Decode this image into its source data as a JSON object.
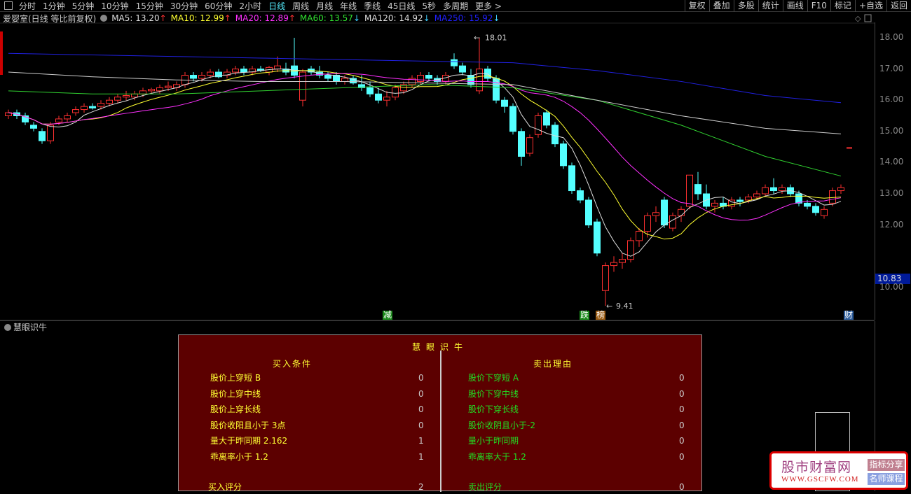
{
  "periods": [
    "分时",
    "1分钟",
    "5分钟",
    "10分钟",
    "15分钟",
    "30分钟",
    "60分钟",
    "2小时",
    "日线",
    "周线",
    "月线",
    "年线",
    "季线",
    "45日线",
    "5秒",
    "多周期",
    "更多 >"
  ],
  "active_period": "日线",
  "right_buttons": [
    "复权",
    "叠加",
    "多股",
    "统计",
    "画线",
    "F10",
    "标记",
    "+自选",
    "返回"
  ],
  "stock_title": "爱婴室(日线 等比前复权)",
  "ma_labels": [
    {
      "text": "MA5: 13.20",
      "arrow": "↑",
      "color": "#dddddd",
      "arrow_color": "#ff3030"
    },
    {
      "text": "MA10: 12.99",
      "arrow": "↑",
      "color": "#ffff30",
      "arrow_color": "#ff3030"
    },
    {
      "text": "MA20: 12.89",
      "arrow": "↑",
      "color": "#ff30ff",
      "arrow_color": "#ff3030"
    },
    {
      "text": "MA60: 13.57",
      "arrow": "↓",
      "color": "#30e030",
      "arrow_color": "#40d0ff"
    },
    {
      "text": "MA120: 14.92",
      "arrow": "↓",
      "color": "#dddddd",
      "arrow_color": "#40d0ff"
    },
    {
      "text": "MA250: 15.92",
      "arrow": "↓",
      "color": "#2020ff",
      "arrow_color": "#40d0ff"
    }
  ],
  "price_axis": [
    "18.00",
    "17.00",
    "16.00",
    "15.00",
    "14.00",
    "13.00",
    "12.00",
    "10.00"
  ],
  "current_price": "10.83",
  "annotations": {
    "high": "18.01",
    "low": "9.41"
  },
  "signals": [
    {
      "text": "减",
      "color": "#1a8a1a"
    },
    {
      "text": "跌",
      "color": "#1a8a1a"
    },
    {
      "text": "榜",
      "color": "#9a5a10"
    },
    {
      "text": "财",
      "color": "#2a5a9a"
    }
  ],
  "chart_data": {
    "type": "candlestick",
    "ylim": [
      9.2,
      18.4
    ],
    "up_color": "#ff3030",
    "down_color": "#54ffff",
    "candles": [
      [
        15.5,
        15.7,
        15.4,
        15.6
      ],
      [
        15.6,
        15.7,
        15.4,
        15.5
      ],
      [
        15.5,
        15.6,
        15.2,
        15.3
      ],
      [
        15.2,
        15.3,
        15.0,
        15.1
      ],
      [
        15.0,
        15.1,
        14.6,
        14.7
      ],
      [
        14.7,
        15.3,
        14.6,
        15.2
      ],
      [
        15.3,
        15.5,
        15.2,
        15.4
      ],
      [
        15.4,
        15.6,
        15.3,
        15.5
      ],
      [
        15.6,
        15.8,
        15.5,
        15.7
      ],
      [
        15.7,
        15.9,
        15.6,
        15.8
      ],
      [
        15.8,
        15.9,
        15.7,
        15.75
      ],
      [
        15.8,
        16.0,
        15.7,
        15.9
      ],
      [
        15.9,
        16.1,
        15.8,
        16.0
      ],
      [
        16.0,
        16.2,
        15.9,
        16.1
      ],
      [
        16.1,
        16.3,
        16.0,
        16.15
      ],
      [
        16.1,
        16.3,
        16.0,
        16.2
      ],
      [
        16.2,
        16.4,
        16.1,
        16.3
      ],
      [
        16.3,
        16.4,
        16.2,
        16.35
      ],
      [
        16.3,
        16.5,
        16.2,
        16.4
      ],
      [
        16.4,
        16.6,
        16.3,
        16.45
      ],
      [
        16.4,
        16.6,
        16.3,
        16.5
      ],
      [
        16.5,
        16.9,
        16.4,
        16.8
      ],
      [
        16.8,
        16.9,
        16.6,
        16.7
      ],
      [
        16.7,
        16.9,
        16.6,
        16.8
      ],
      [
        16.8,
        17.0,
        16.7,
        16.9
      ],
      [
        16.9,
        17.0,
        16.7,
        16.75
      ],
      [
        16.8,
        17.0,
        16.7,
        16.9
      ],
      [
        16.9,
        17.1,
        16.8,
        17.0
      ],
      [
        17.0,
        17.1,
        16.8,
        16.9
      ],
      [
        16.9,
        17.1,
        16.8,
        17.0
      ],
      [
        17.0,
        17.1,
        16.9,
        16.95
      ],
      [
        16.9,
        17.1,
        16.8,
        17.05
      ],
      [
        17.0,
        17.4,
        16.9,
        17.1
      ],
      [
        17.0,
        17.2,
        16.8,
        16.9
      ],
      [
        17.1,
        18.0,
        16.7,
        16.8
      ],
      [
        16.0,
        17.0,
        15.8,
        16.9
      ],
      [
        17.0,
        17.1,
        16.8,
        16.9
      ],
      [
        16.9,
        17.1,
        16.7,
        16.8
      ],
      [
        16.8,
        16.9,
        16.6,
        16.7
      ],
      [
        16.8,
        16.9,
        16.5,
        16.6
      ],
      [
        16.6,
        16.8,
        16.5,
        16.7
      ],
      [
        16.7,
        16.8,
        16.5,
        16.55
      ],
      [
        16.5,
        16.8,
        16.3,
        16.4
      ],
      [
        16.4,
        16.6,
        16.1,
        16.2
      ],
      [
        16.2,
        16.4,
        15.9,
        16.0
      ],
      [
        16.0,
        16.3,
        15.8,
        16.1
      ],
      [
        16.1,
        16.5,
        16.0,
        16.4
      ],
      [
        16.3,
        16.6,
        16.2,
        16.5
      ],
      [
        16.5,
        16.8,
        16.4,
        16.7
      ],
      [
        16.6,
        16.9,
        16.5,
        16.8
      ],
      [
        16.8,
        16.9,
        16.6,
        16.7
      ],
      [
        16.7,
        16.8,
        16.5,
        16.6
      ],
      [
        16.6,
        16.9,
        16.5,
        16.8
      ],
      [
        17.3,
        17.5,
        17.0,
        17.1
      ],
      [
        17.1,
        17.2,
        16.8,
        16.9
      ],
      [
        16.8,
        17.0,
        16.4,
        16.5
      ],
      [
        16.3,
        18.01,
        16.2,
        17.0
      ],
      [
        17.0,
        17.1,
        16.6,
        16.7
      ],
      [
        16.7,
        16.8,
        15.9,
        16.0
      ],
      [
        16.0,
        16.1,
        15.6,
        15.8
      ],
      [
        15.8,
        15.9,
        14.9,
        15.0
      ],
      [
        15.0,
        15.1,
        13.9,
        14.2
      ],
      [
        14.3,
        14.9,
        14.2,
        14.8
      ],
      [
        14.9,
        15.6,
        14.8,
        15.5
      ],
      [
        15.6,
        15.7,
        15.1,
        15.2
      ],
      [
        15.2,
        15.3,
        14.5,
        14.6
      ],
      [
        14.6,
        14.7,
        13.8,
        13.9
      ],
      [
        13.9,
        14.0,
        13.0,
        13.1
      ],
      [
        13.1,
        13.2,
        12.7,
        12.8
      ],
      [
        12.8,
        12.9,
        11.9,
        12.0
      ],
      [
        12.1,
        12.2,
        11.0,
        11.1
      ],
      [
        9.9,
        10.8,
        9.41,
        10.7
      ],
      [
        10.7,
        11.0,
        10.5,
        10.8
      ],
      [
        10.8,
        11.1,
        10.6,
        10.9
      ],
      [
        10.9,
        11.6,
        10.8,
        11.5
      ],
      [
        11.5,
        11.9,
        11.3,
        11.8
      ],
      [
        11.8,
        12.4,
        11.6,
        12.3
      ],
      [
        12.3,
        12.6,
        12.1,
        12.4
      ],
      [
        12.8,
        12.9,
        11.9,
        12.0
      ],
      [
        11.9,
        12.4,
        11.8,
        12.3
      ],
      [
        12.3,
        12.6,
        12.1,
        12.5
      ],
      [
        12.6,
        13.6,
        12.5,
        13.6
      ],
      [
        13.3,
        13.7,
        12.8,
        13.0
      ],
      [
        13.0,
        13.3,
        12.5,
        12.6
      ],
      [
        12.6,
        12.8,
        12.4,
        12.7
      ],
      [
        12.7,
        12.9,
        12.5,
        12.6
      ],
      [
        12.6,
        12.9,
        12.5,
        12.8
      ],
      [
        12.8,
        12.9,
        12.6,
        12.75
      ],
      [
        12.8,
        13.0,
        12.7,
        12.9
      ],
      [
        12.9,
        13.1,
        12.8,
        13.0
      ],
      [
        13.0,
        13.3,
        12.9,
        13.2
      ],
      [
        13.2,
        13.5,
        13.0,
        13.1
      ],
      [
        13.1,
        13.3,
        13.0,
        13.2
      ],
      [
        13.2,
        13.3,
        12.9,
        13.0
      ],
      [
        13.0,
        13.1,
        12.6,
        12.7
      ],
      [
        12.7,
        12.8,
        12.5,
        12.6
      ],
      [
        12.6,
        12.7,
        12.3,
        12.4
      ],
      [
        12.3,
        12.6,
        12.2,
        12.5
      ],
      [
        12.7,
        13.2,
        12.6,
        13.1
      ],
      [
        13.1,
        13.3,
        13.0,
        13.2
      ]
    ],
    "ma_computed": [
      {
        "name": "MA5",
        "period": 5,
        "color": "#dddddd"
      },
      {
        "name": "MA10",
        "period": 10,
        "color": "#ffff30"
      },
      {
        "name": "MA20",
        "period": 20,
        "color": "#ff30ff"
      }
    ],
    "ma_sampled": {
      "sample_index": [
        0,
        10,
        20,
        30,
        40,
        50,
        60,
        70,
        80,
        90,
        99
      ],
      "series": [
        {
          "name": "MA60",
          "color": "#30d030",
          "values": [
            16.3,
            16.2,
            16.2,
            16.3,
            16.4,
            16.5,
            16.4,
            16.0,
            15.2,
            14.2,
            13.57
          ]
        },
        {
          "name": "MA120",
          "color": "#cccccc",
          "values": [
            16.9,
            16.75,
            16.65,
            16.6,
            16.6,
            16.55,
            16.5,
            16.0,
            15.5,
            15.1,
            14.92
          ]
        },
        {
          "name": "MA250",
          "color": "#2020e0",
          "values": [
            17.5,
            17.45,
            17.4,
            17.35,
            17.3,
            17.25,
            17.2,
            16.95,
            16.6,
            16.15,
            15.92
          ]
        }
      ]
    }
  },
  "indicator": {
    "title": "慧眼识牛",
    "panel_title": "慧眼识牛",
    "buy_header": "买入条件",
    "sell_header": "卖出理由",
    "buy_rows": [
      {
        "label": "股价上穿短 B",
        "value": "0"
      },
      {
        "label": "股价上穿中线",
        "value": "0"
      },
      {
        "label": "股价上穿长线",
        "value": "0"
      },
      {
        "label": "股价收阳且小于 3点",
        "value": "0"
      },
      {
        "label": "量大于昨同期   2.162",
        "value": "1"
      },
      {
        "label": "乖离率小于 1.2",
        "value": "1"
      }
    ],
    "sell_rows": [
      {
        "label": "股价下穿短 A",
        "value": "0"
      },
      {
        "label": "股价下穿中线",
        "value": "0"
      },
      {
        "label": "股价下穿长线",
        "value": "0"
      },
      {
        "label": "股价收阴且小于-2",
        "value": "0"
      },
      {
        "label": "量小于昨同期",
        "value": "0"
      },
      {
        "label": "乖离率大于 1.2",
        "value": "0"
      }
    ],
    "buy_score_label": "买入评分",
    "buy_score": "2",
    "sell_score_label": "卖出评分",
    "sell_score": "0"
  },
  "watermark": {
    "name": "股市财富网",
    "url": "WWW.GSCFW.COM",
    "tag1": "指标分享",
    "tag2": "名师课程"
  }
}
